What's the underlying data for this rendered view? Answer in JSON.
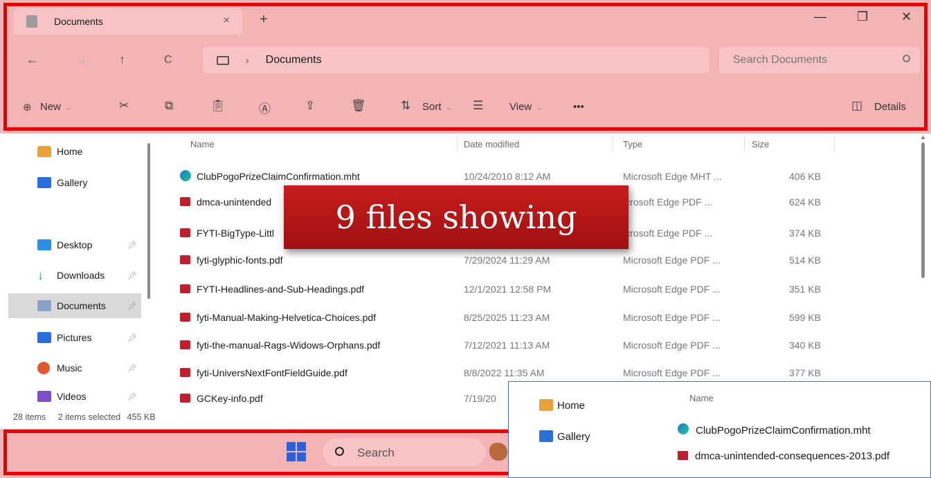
{
  "window": {
    "tab_title": "Documents",
    "tab_close": "×",
    "new_tab": "+",
    "minimize": "—",
    "maximize": "❐",
    "close": "✕"
  },
  "nav": {
    "back": "←",
    "forward": "→",
    "up": "↑",
    "refresh": "C",
    "breadcrumb_sep": "›",
    "breadcrumb": "Documents",
    "search_placeholder": "Search Documents"
  },
  "toolbar": {
    "new_label": "New",
    "sort_label": "Sort",
    "view_label": "View",
    "more_label": "•••",
    "details_label": "Details"
  },
  "sidebar": {
    "items": [
      {
        "label": "Home",
        "icon": "home-icon",
        "color": "#e9a23b"
      },
      {
        "label": "Gallery",
        "icon": "gallery-icon",
        "color": "#2a6fdb"
      },
      {
        "label": "Desktop",
        "icon": "desktop-icon",
        "color": "#2f8fe0"
      },
      {
        "label": "Downloads",
        "icon": "downloads-icon",
        "color": "#27a35a"
      },
      {
        "label": "Documents",
        "icon": "documents-icon",
        "color": "#8aa4c8"
      },
      {
        "label": "Pictures",
        "icon": "pictures-icon",
        "color": "#2a6fdb"
      },
      {
        "label": "Music",
        "icon": "music-icon",
        "color": "#e4572e"
      },
      {
        "label": "Videos",
        "icon": "videos-icon",
        "color": "#7b4fc9"
      }
    ]
  },
  "columns": {
    "name": "Name",
    "date": "Date modified",
    "type": "Type",
    "size": "Size"
  },
  "files": [
    {
      "name": "ClubPogoPrizeClaimConfirmation.mht",
      "date": "10/24/2010 8:12 AM",
      "type": "Microsoft Edge MHT ...",
      "size": "406 KB",
      "icon": "edge"
    },
    {
      "name": "dmca-unintended",
      "date": "",
      "type": "icrosoft Edge PDF ...",
      "size": "624 KB",
      "icon": "pdf"
    },
    {
      "name": "FYTI-BigType-Littl",
      "date": "",
      "type": "icrosoft Edge PDF ...",
      "size": "374 KB",
      "icon": "pdf"
    },
    {
      "name": "fyti-glyphic-fonts.pdf",
      "date": "7/29/2024 11:29 AM",
      "type": "Microsoft Edge PDF ...",
      "size": "514 KB",
      "icon": "pdf"
    },
    {
      "name": "FYTI-Headlines-and-Sub-Headings.pdf",
      "date": "12/1/2021 12:58 PM",
      "type": "Microsoft Edge PDF ...",
      "size": "351 KB",
      "icon": "pdf"
    },
    {
      "name": "fyti-Manual-Making-Helvetica-Choices.pdf",
      "date": "8/25/2025 11:23 AM",
      "type": "Microsoft Edge PDF ...",
      "size": "599 KB",
      "icon": "pdf"
    },
    {
      "name": "fyti-the-manual-Rags-Widows-Orphans.pdf",
      "date": "7/12/2021 11:13 AM",
      "type": "Microsoft Edge PDF ...",
      "size": "340 KB",
      "icon": "pdf"
    },
    {
      "name": "fyti-UniversNextFontFieldGuide.pdf",
      "date": "8/8/2022 11:35 AM",
      "type": "Microsoft Edge PDF ...",
      "size": "377 KB",
      "icon": "pdf"
    },
    {
      "name": "GCKey-info.pdf",
      "date": "7/19/20",
      "type": "",
      "size": "",
      "icon": "pdf"
    }
  ],
  "status": {
    "count": "28 items",
    "selected": "2 items selected",
    "size": "455 KB"
  },
  "taskbar": {
    "search_label": "Search"
  },
  "callout": {
    "text": "9 files showing"
  },
  "inset": {
    "home": "Home",
    "gallery": "Gallery",
    "col_name": "Name",
    "row1": "ClubPogoPrizeClaimConfirmation.mht",
    "row2": "dmca-unintended-consequences-2013.pdf"
  },
  "colors": {
    "highlight_outline": "#e60000",
    "highlight_tint": "#f4b3b5",
    "callout": "#b51717",
    "pdf_icon": "#c0202b"
  }
}
